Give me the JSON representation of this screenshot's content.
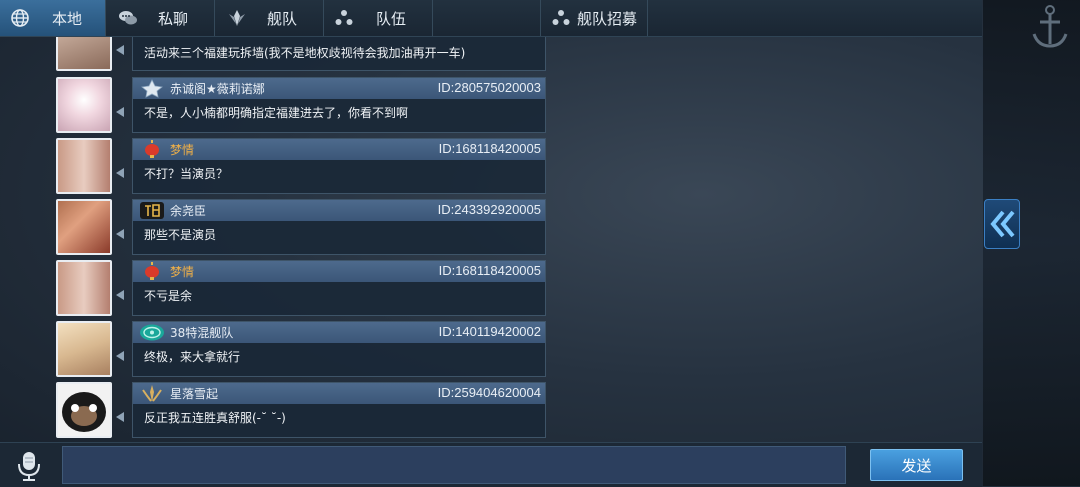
{
  "tabs": [
    {
      "label": "本地",
      "icon": "globe-icon",
      "active": true
    },
    {
      "label": "私聊",
      "icon": "chat-bubbles-icon",
      "active": false
    },
    {
      "label": "舰队",
      "icon": "fleet-emblem-icon",
      "active": false
    },
    {
      "label": "队伍",
      "icon": "team-dots-icon",
      "active": false
    },
    {
      "label": "舰队招募",
      "icon": "team-dots-icon",
      "active": false
    }
  ],
  "messages": [
    {
      "name": "",
      "id": "",
      "text": "活动来三个福建玩拆墙(我不是地权歧视待会我加油再开一车)",
      "badge": "",
      "name_color": "#e8eef5"
    },
    {
      "name": "赤诚阁★薇莉诺娜",
      "id": "ID:280575020003",
      "text": "不是，人小楠都明确指定福建进去了，你看不到啊",
      "badge": "star-badge-icon",
      "name_color": "#e8eef5"
    },
    {
      "name": "梦情",
      "id": "ID:168118420005",
      "text": "不打？当演员？",
      "badge": "lantern-badge-icon",
      "name_color": "#f0b048"
    },
    {
      "name": "余尧臣",
      "id": "ID:243392920005",
      "text": "那些不是演员",
      "badge": "fu-badge-icon",
      "name_color": "#e8eef5"
    },
    {
      "name": "梦情",
      "id": "ID:168118420005",
      "text": "不亏是余",
      "badge": "lantern-badge-icon",
      "name_color": "#f0b048"
    },
    {
      "name": "38特混舰队",
      "id": "ID:140119420002",
      "text": "终极，来大拿就行",
      "badge": "teal-emblem-badge-icon",
      "name_color": "#e8eef5"
    },
    {
      "name": "星落雪起",
      "id": "ID:259404620004",
      "text": "反正我五连胜真舒服(-˘ ˘-)",
      "badge": "laurel-badge-icon",
      "name_color": "#e8eef5"
    }
  ],
  "input": {
    "value": "",
    "placeholder": ""
  },
  "send_label": "发送",
  "colors": {
    "accent": "#3b6f9c",
    "send_button": "#3a8ccf",
    "bubble_header": "#4d6a8d"
  }
}
